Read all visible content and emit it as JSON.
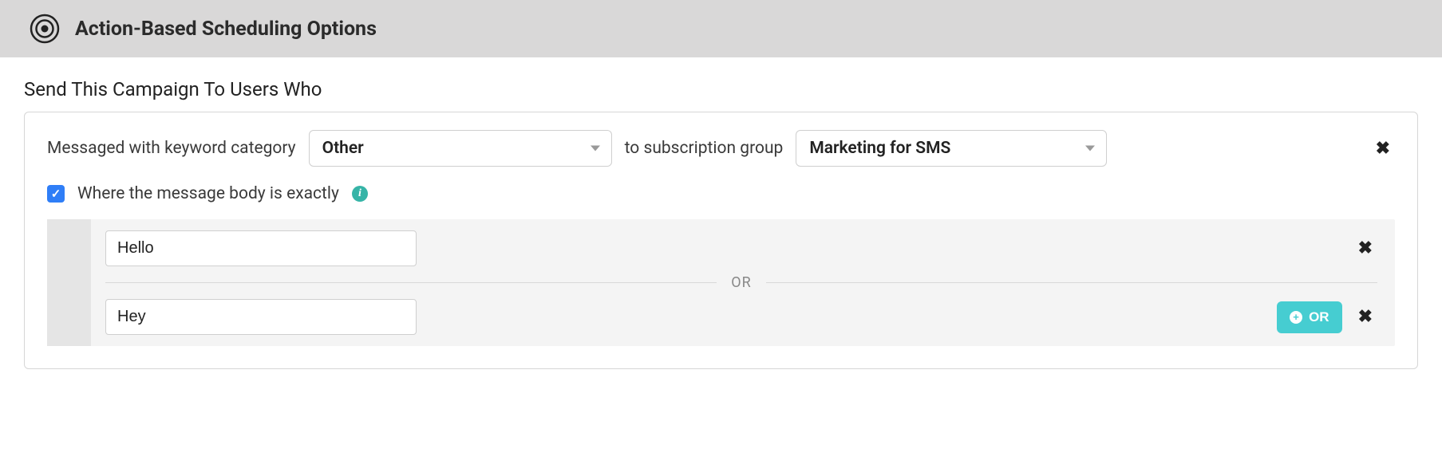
{
  "header": {
    "title": "Action-Based Scheduling Options"
  },
  "section": {
    "label": "Send This Campaign To Users Who"
  },
  "trigger": {
    "prefix_text": "Messaged with keyword category",
    "category_selected": "Other",
    "middle_text": "to subscription group",
    "group_selected": "Marketing for SMS",
    "body_check_label": "Where the message body is exactly"
  },
  "conditions": {
    "items": [
      {
        "value": "Hello"
      },
      {
        "value": "Hey"
      }
    ],
    "or_divider_label": "OR",
    "add_or_label": "OR"
  }
}
